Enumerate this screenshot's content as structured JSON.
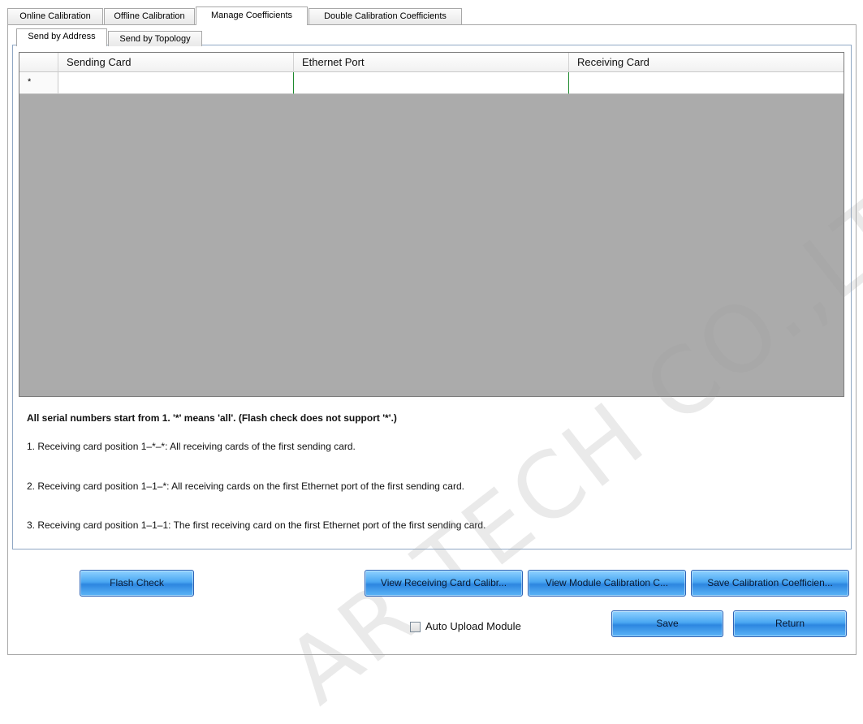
{
  "outer_tabs": [
    {
      "label": "Online Calibration"
    },
    {
      "label": "Offline Calibration"
    },
    {
      "label": "Manage Coefficients"
    },
    {
      "label": "Double Calibration Coefficients"
    }
  ],
  "inner_tabs": [
    {
      "label": "Send by Address"
    },
    {
      "label": "Send by Topology"
    }
  ],
  "grid": {
    "columns": [
      "Sending Card",
      "Ethernet Port",
      "Receiving Card"
    ],
    "new_row_marker": "*"
  },
  "notes": {
    "heading": "All serial numbers start from 1. '*' means 'all'. (Flash check does not support '*'.)",
    "items": [
      "1. Receiving card position 1–*–*: All receiving cards of the first sending card.",
      "2. Receiving card position 1–1–*: All receiving cards on the first Ethernet port of the first sending card.",
      "3. Receiving card position 1–1–1: The first receiving card on the first Ethernet port of the first sending card."
    ]
  },
  "buttons": {
    "flash_check": "Flash Check",
    "view_receiving": "View Receiving Card Calibr...",
    "view_module": "View Module Calibration C...",
    "save_coeff": "Save Calibration Coefficien...",
    "save": "Save",
    "return": "Return"
  },
  "auto_upload": {
    "label": "Auto Upload Module",
    "checked": false
  },
  "watermark": "AR TECH CO.,LTD.",
  "colors": {
    "accent_button": "#4aa7f2",
    "grid_bg": "#ababab",
    "cell_divider": "#1e8a2e"
  }
}
